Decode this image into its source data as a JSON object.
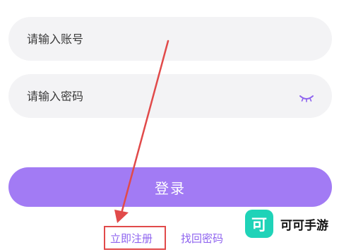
{
  "login_form": {
    "account_placeholder": "请输入账号",
    "account_value": "",
    "password_placeholder": "请输入密码",
    "password_value": "",
    "password_visibility_icon": "eye-closed-icon",
    "login_label": "登录"
  },
  "links": {
    "register_label": "立即注册",
    "recover_password_label": "找回密码"
  },
  "watermark": {
    "logo_glyph": "可",
    "brand_text": "可可手游"
  },
  "colors": {
    "accent": "#a27bf4",
    "link": "#8e63ef",
    "field_background": "#f3f3f5",
    "annotation": "#e14a4a",
    "watermark_logo": "#1fd3b8"
  }
}
